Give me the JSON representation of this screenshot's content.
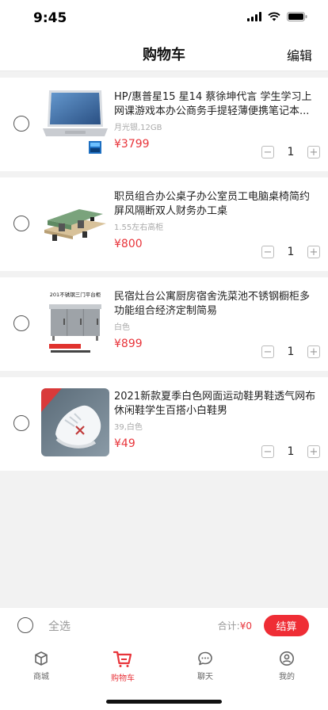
{
  "status_bar": {
    "time": "9:45"
  },
  "nav": {
    "title": "购物车",
    "edit_label": "编辑"
  },
  "items": [
    {
      "title": "HP/惠普星15 星14 蔡徐坤代言 学生学习上网课游戏本办公商务手提轻薄便携笔记本...",
      "spec": "月光银,12GB",
      "price": "¥3799",
      "qty": "1",
      "image": "laptop"
    },
    {
      "title": "职员组合办公桌子办公室员工电脑桌椅简约屏风隔断双人财务办工桌",
      "spec": "1.55左右高柜",
      "price": "¥800",
      "qty": "1",
      "image": "office-desks"
    },
    {
      "title": "民宿灶台公寓厨房宿舍洗菜池不锈钢橱柜多功能组合经济定制简易",
      "spec": "白色",
      "price": "¥899",
      "qty": "1",
      "image": "steel-cabinet",
      "image_caption": "201不锈钢三门平台柜"
    },
    {
      "title": "2021新款夏季白色网面运动鞋男鞋透气网布休闲鞋学生百搭小白鞋男",
      "spec": "39,白色",
      "price": "¥49",
      "qty": "1",
      "image": "white-sneaker"
    }
  ],
  "bottom_bar": {
    "select_all": "全选",
    "total_label": "合计:",
    "total_value": "¥0",
    "checkout": "结算"
  },
  "tabs": [
    {
      "label": "商城",
      "icon": "cube-icon",
      "active": false
    },
    {
      "label": "购物车",
      "icon": "cart-icon",
      "active": true
    },
    {
      "label": "聊天",
      "icon": "chat-icon",
      "active": false
    },
    {
      "label": "我的",
      "icon": "user-icon",
      "active": false
    }
  ],
  "colors": {
    "accent": "#e8343a",
    "checkout": "#ef2d35"
  }
}
